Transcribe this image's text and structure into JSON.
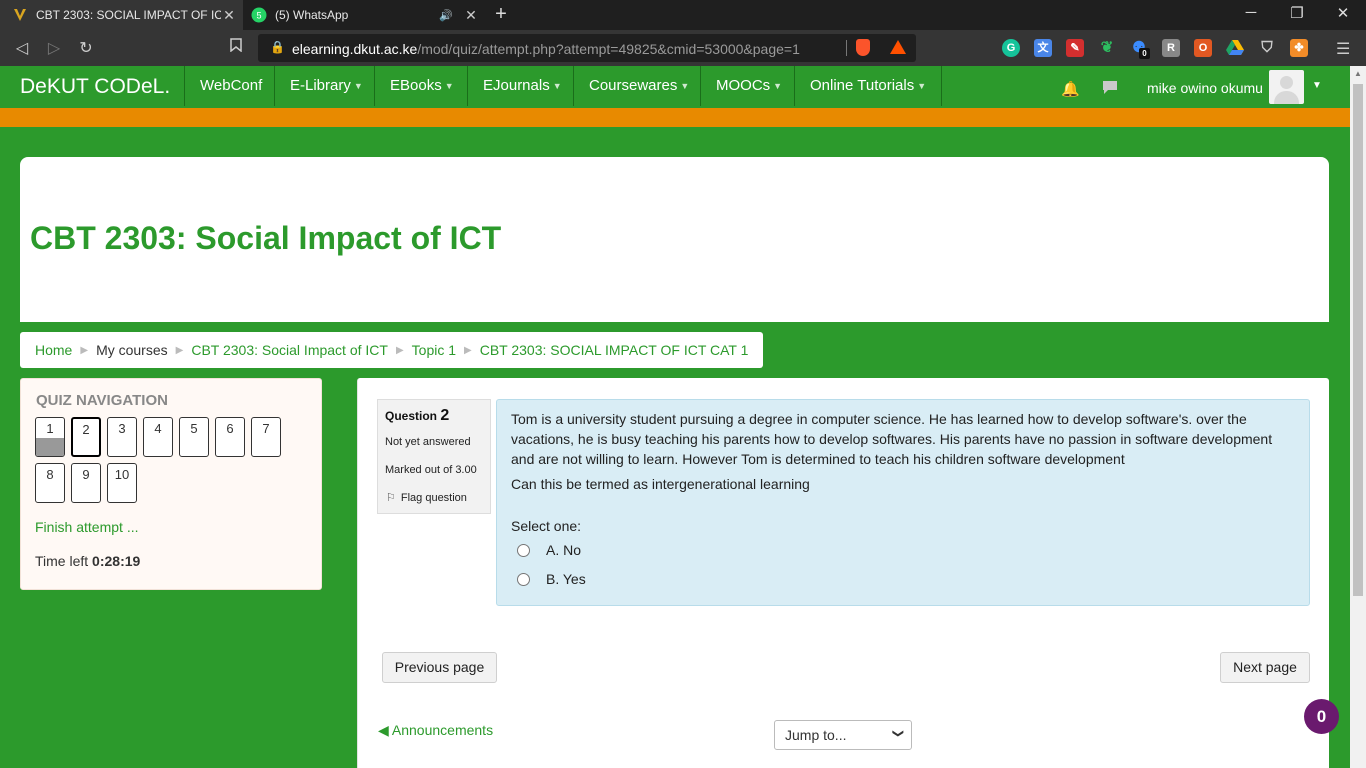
{
  "browser": {
    "tabs": [
      {
        "title": "CBT 2303: SOCIAL IMPACT OF ICT C",
        "close": "✕",
        "active": true
      },
      {
        "title": "(5) WhatsApp",
        "close": "✕",
        "badge": "5",
        "active": false
      }
    ],
    "new_tab": "+",
    "url_domain": "elearning.dkut.ac.ke",
    "url_path": "/mod/quiz/attempt.php?attempt=49825&cmid=53000&page=1",
    "ext_badge": "0"
  },
  "site": {
    "brand": "DeKUT CODeL.",
    "nav": [
      {
        "label": "WebConf",
        "dropdown": false
      },
      {
        "label": "E-Library",
        "dropdown": true
      },
      {
        "label": "EBooks",
        "dropdown": true
      },
      {
        "label": "EJournals",
        "dropdown": true
      },
      {
        "label": "Coursewares",
        "dropdown": true
      },
      {
        "label": "MOOCs",
        "dropdown": true
      },
      {
        "label": "Online Tutorials",
        "dropdown": true
      }
    ],
    "username": "mike owino okumu",
    "accent": "#2c9a2c",
    "stripe": "#e88a00"
  },
  "page": {
    "title": "CBT 2303: Social Impact of ICT",
    "breadcrumb": [
      "Home",
      "My courses",
      "CBT 2303: Social Impact of ICT",
      "Topic 1",
      "CBT 2303: SOCIAL IMPACT OF ICT CAT 1"
    ]
  },
  "quiz_nav": {
    "title": "QUIZ NAVIGATION",
    "questions": [
      {
        "n": "1",
        "answered": true,
        "current": false
      },
      {
        "n": "2",
        "answered": false,
        "current": true
      },
      {
        "n": "3",
        "answered": false,
        "current": false
      },
      {
        "n": "4",
        "answered": false,
        "current": false
      },
      {
        "n": "5",
        "answered": false,
        "current": false
      },
      {
        "n": "6",
        "answered": false,
        "current": false
      },
      {
        "n": "7",
        "answered": false,
        "current": false
      },
      {
        "n": "8",
        "answered": false,
        "current": false
      },
      {
        "n": "9",
        "answered": false,
        "current": false
      },
      {
        "n": "10",
        "answered": false,
        "current": false
      }
    ],
    "finish": "Finish attempt ...",
    "time_label": "Time left",
    "time_value": "0:28:19"
  },
  "question": {
    "label": "Question",
    "number": "2",
    "state": "Not yet answered",
    "grade": "Marked out of 3.00",
    "flag": "Flag question",
    "text": "Tom is a university student pursuing a degree in computer science. He has learned how to develop software's. over the vacations, he is busy teaching his parents how to develop softwares. His parents have no passion in software development and are not willing to learn. However Tom is determined to teach his children software development",
    "prompt": "Can this be termed as intergenerational learning",
    "select_label": "Select one:",
    "options": [
      "A. No",
      "B. Yes"
    ]
  },
  "footer": {
    "prev": "Previous page",
    "next": "Next page",
    "announcements": "◀ Announcements",
    "jump": "Jump to...",
    "badge_count": "0"
  }
}
